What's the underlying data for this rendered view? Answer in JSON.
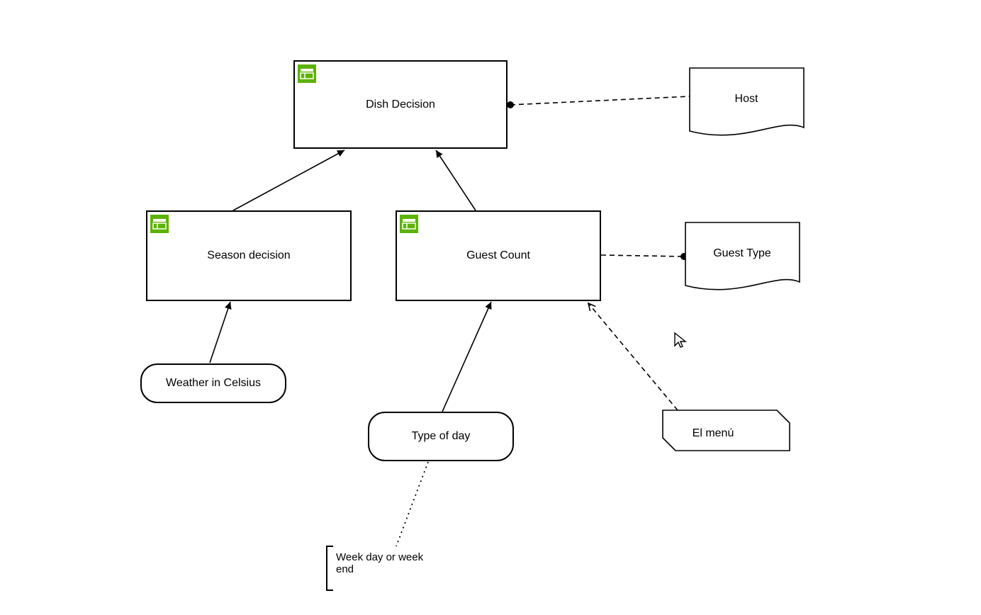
{
  "nodes": {
    "dish_decision": {
      "label": "Dish Decision"
    },
    "season_decision": {
      "label": "Season decision"
    },
    "guest_count": {
      "label": "Guest Count"
    },
    "weather": {
      "label": "Weather in Celsius"
    },
    "type_of_day": {
      "label": "Type of day"
    },
    "host": {
      "label": "Host"
    },
    "guest_type": {
      "label": "Guest Type"
    },
    "el_menu": {
      "label": "El menú"
    }
  },
  "annotation": {
    "type_of_day_note_line1": "Week day or week",
    "type_of_day_note_line2": "end"
  },
  "colors": {
    "badge_green": "#5cb300",
    "stroke": "#000000"
  }
}
